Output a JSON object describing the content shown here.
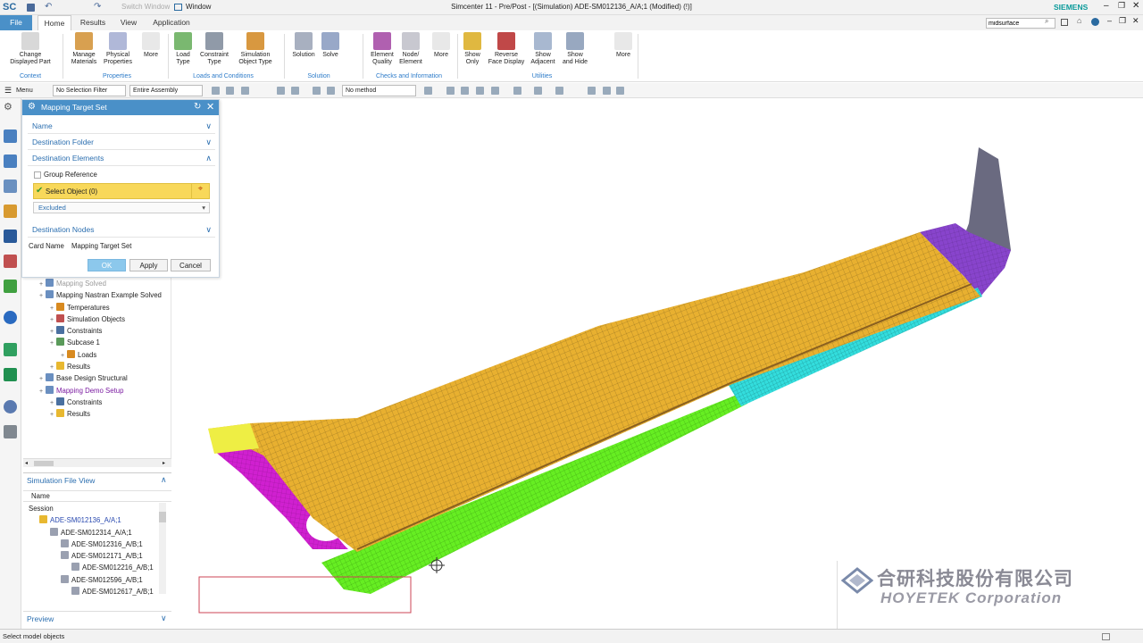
{
  "titlebar": {
    "logo": "SC",
    "switch_window": "Switch Window",
    "window_menu": "Window",
    "title": "Simcenter 11 - Pre/Post - [(Simulation) ADE-SM012136_A/A;1 (Modified)   (!)]",
    "brand": "SIEMENS"
  },
  "menubar": {
    "tabs": [
      "File",
      "Home",
      "Results",
      "View",
      "Application"
    ],
    "search_value": "midsurface"
  },
  "ribbon": {
    "buttons": [
      {
        "label": "Change\nDisplayed Part",
        "icon": "change-part-icon"
      },
      {
        "label": "Manage\nMaterials",
        "icon": "materials-icon"
      },
      {
        "label": "Physical\nProperties",
        "icon": "physical-properties-icon"
      },
      {
        "label": "More",
        "icon": "more-icon"
      },
      {
        "label": "Load\nType",
        "icon": "load-icon"
      },
      {
        "label": "Constraint\nType",
        "icon": "constraint-icon"
      },
      {
        "label": "Simulation\nObject Type",
        "icon": "simulation-object-icon"
      },
      {
        "label": "Solution",
        "icon": "solution-icon"
      },
      {
        "label": "Solve",
        "icon": "solve-icon"
      },
      {
        "label": "Element\nQuality",
        "icon": "element-quality-icon"
      },
      {
        "label": "Node/\nElement",
        "icon": "node-element-icon"
      },
      {
        "label": "More",
        "icon": "more-icon"
      },
      {
        "label": "Show\nOnly",
        "icon": "show-only-icon"
      },
      {
        "label": "Reverse\nFace Display",
        "icon": "reverse-face-icon"
      },
      {
        "label": "Show\nAdjacent",
        "icon": "show-adjacent-icon"
      },
      {
        "label": "Show\nand Hide",
        "icon": "show-hide-icon"
      },
      {
        "label": "More",
        "icon": "more-icon"
      }
    ],
    "groups": [
      "Context",
      "Properties",
      "Loads and Conditions",
      "Solution",
      "Checks and Information",
      "Utilities"
    ]
  },
  "toolbar2": {
    "menu": "Menu",
    "selection_filter": "No Selection Filter",
    "assembly_scope": "Entire Assembly",
    "method": "No method"
  },
  "dialog": {
    "title": "Mapping Target Set",
    "sections": {
      "name": "Name",
      "destination_folder": "Destination Folder",
      "destination_elements": "Destination Elements",
      "destination_nodes": "Destination Nodes"
    },
    "group_reference": "Group Reference",
    "select_object": "Select Object (0)",
    "excluded": "Excluded",
    "card_name_label": "Card Name",
    "card_name_value": "Mapping Target Set",
    "ok": "OK",
    "apply": "Apply",
    "cancel": "Cancel"
  },
  "tree": {
    "items": [
      {
        "label": "Mapping Solved",
        "indent": 1,
        "color": "#6a8fc0"
      },
      {
        "label": "Mapping Nastran Example Solved",
        "indent": 1,
        "color": "#6a8fc0"
      },
      {
        "label": "Temperatures",
        "indent": 2,
        "color": "#d88a20"
      },
      {
        "label": "Simulation Objects",
        "indent": 2,
        "color": "#c05050"
      },
      {
        "label": "Constraints",
        "indent": 2,
        "color": "#4a70a0"
      },
      {
        "label": "Subcase 1",
        "indent": 2,
        "color": "#5a9a5a"
      },
      {
        "label": "Loads",
        "indent": 3,
        "color": "#d88a20"
      },
      {
        "label": "Results",
        "indent": 2,
        "color": "#e8b830"
      },
      {
        "label": "Base Design Structural",
        "indent": 1,
        "color": "#6a8fc0"
      },
      {
        "label": "Mapping Demo Setup",
        "indent": 1,
        "color": "#6a8fc0",
        "active": true
      },
      {
        "label": "Constraints",
        "indent": 2,
        "color": "#4a70a0"
      },
      {
        "label": "Results",
        "indent": 2,
        "color": "#e8b830"
      }
    ]
  },
  "sim_file_view": {
    "title": "Simulation File View",
    "column": "Name",
    "rows": [
      {
        "label": "Session",
        "indent": 0
      },
      {
        "label": "ADE-SM012136_A/A;1",
        "indent": 1,
        "active": true
      },
      {
        "label": "ADE-SM012314_A/A;1",
        "indent": 2
      },
      {
        "label": "ADE-SM012316_A/B;1",
        "indent": 3
      },
      {
        "label": "ADE-SM012171_A/B;1",
        "indent": 3
      },
      {
        "label": "ADE-SM012216_A/B;1",
        "indent": 4
      },
      {
        "label": "ADE-SM012596_A/B;1",
        "indent": 3
      },
      {
        "label": "ADE-SM012617_A/B;1",
        "indent": 4
      }
    ]
  },
  "preview": "Preview",
  "status": "Select model objects",
  "watermark": {
    "cn": "合研科技股份有限公司",
    "en": "HOYETEK Corporation"
  },
  "colors": {
    "accent": "#4a90c8",
    "select_bg": "#f8d85a",
    "mesh_yellow": "#e8b030",
    "mesh_green": "#66ee22",
    "mesh_cyan": "#33dddd",
    "mesh_magenta": "#d020d0",
    "mesh_purple": "#8844cc",
    "mesh_grey": "#6a6a80"
  }
}
